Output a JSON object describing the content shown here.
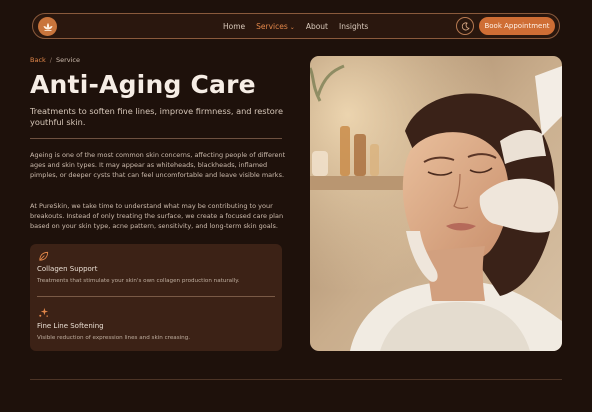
{
  "nav": {
    "links": [
      {
        "label": "Home"
      },
      {
        "label": "Services"
      },
      {
        "label": "About"
      },
      {
        "label": "Insights"
      }
    ],
    "cta_label": "Book Appointment",
    "logo_icon": "lotus-icon",
    "theme_icon": "moon-icon"
  },
  "breadcrumb": {
    "back": "Back",
    "separator": "/",
    "current": "Service"
  },
  "page": {
    "title": "Anti-Aging Care",
    "subtitle": "Treatments to soften fine lines, improve firmness, and restore youthful skin.",
    "paragraphs": [
      "Ageing is one of the most common skin concerns, affecting people of different ages and skin types. It may appear as whiteheads, blackheads, inflamed pimples, or deeper cysts that can feel uncomfortable and leave visible marks.",
      "At PureSkin, we take time to understand what may be contributing to your breakouts. Instead of only treating the surface, we create a focused care plan based on your skin type, acne pattern, sensitivity, and long-term skin goals."
    ]
  },
  "features": [
    {
      "icon": "leaf-icon",
      "title": "Collagen Support",
      "desc": "Treatments that stimulate your skin's own collagen production naturally."
    },
    {
      "icon": "sparkle-icon",
      "title": "Fine Line Softening",
      "desc": "Visible reduction of expression lines and skin creasing."
    }
  ],
  "colors": {
    "accent": "#cf6e35",
    "background": "#1e110b",
    "card": "#3c2216"
  }
}
